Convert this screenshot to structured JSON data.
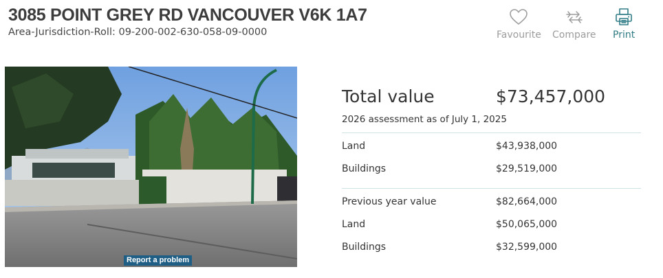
{
  "header": {
    "address": "3085 POINT GREY RD VANCOUVER V6K 1A7",
    "roll": "Area-Jurisdiction-Roll: 09-200-002-630-058-09-0000"
  },
  "actions": {
    "favourite": {
      "label": "Favourite",
      "icon": "heart-icon"
    },
    "compare": {
      "label": "Compare",
      "icon": "compare-arrows-icon"
    },
    "print": {
      "label": "Print",
      "icon": "printer-icon"
    }
  },
  "photo": {
    "report_label": "Report a problem"
  },
  "assessment": {
    "total_label": "Total value",
    "total_value": "$73,457,000",
    "as_of": "2026 assessment as of July 1, 2025",
    "current": [
      {
        "label": "Land",
        "value": "$43,938,000"
      },
      {
        "label": "Buildings",
        "value": "$29,519,000"
      }
    ],
    "previous": [
      {
        "label": "Previous year value",
        "value": "$82,664,000"
      },
      {
        "label": "Land",
        "value": "$50,065,000"
      },
      {
        "label": "Buildings",
        "value": "$32,599,000"
      }
    ]
  },
  "colors": {
    "accent": "#2f7c86",
    "muted": "#9c9c9c",
    "report_bg": "#1f5f86",
    "divider": "#cfe3e4"
  }
}
